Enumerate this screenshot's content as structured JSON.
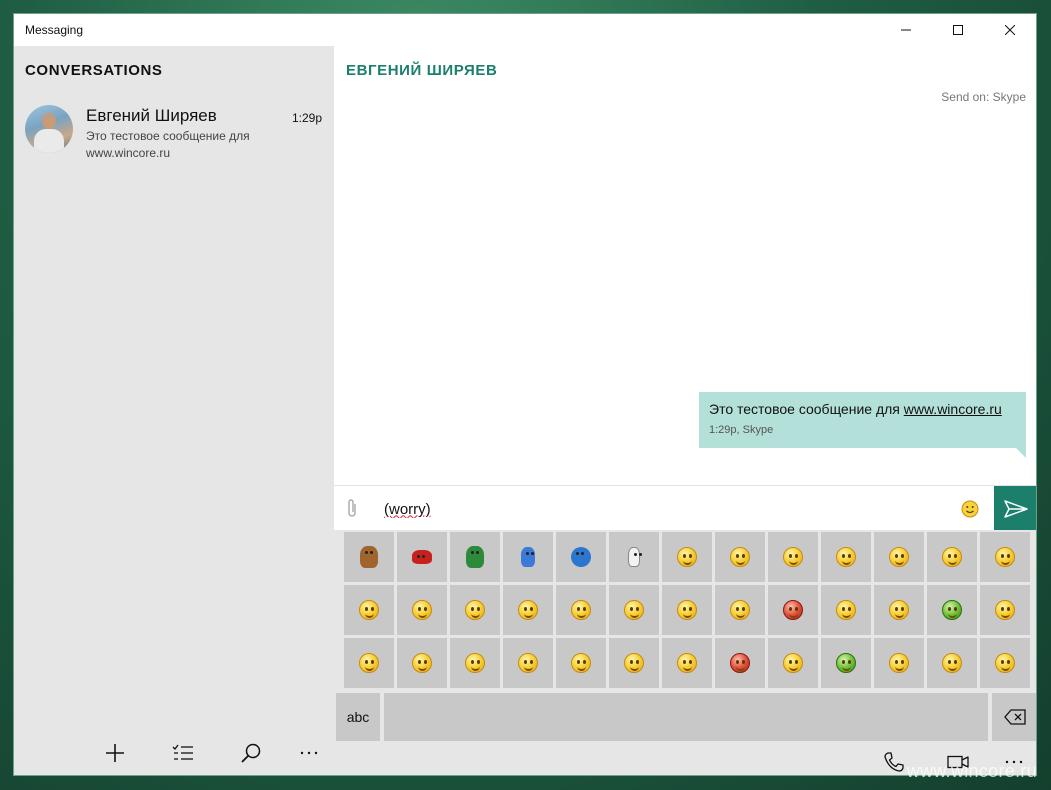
{
  "window": {
    "title": "Messaging"
  },
  "left": {
    "heading": "CONVERSATIONS",
    "conversation": {
      "name": "Евгений Ширяев",
      "time": "1:29p",
      "preview": "Это тестовое сообщение для www.wincore.ru"
    }
  },
  "chat": {
    "contact": "ЕВГЕНИЙ ШИРЯЕВ",
    "send_on": "Send on: Skype",
    "message": {
      "text_prefix": "Это тестовое сообщение для ",
      "link": "www.wincore.ru",
      "meta": "1:29p, Skype"
    },
    "compose_value": "(worry)"
  },
  "keyboard": {
    "abc_label": "abc"
  },
  "watermark": "www.wincore.ru",
  "colors": {
    "accent": "#1c7f6c",
    "bubble": "#b3e0d8",
    "panel": "#e6e6e6"
  }
}
